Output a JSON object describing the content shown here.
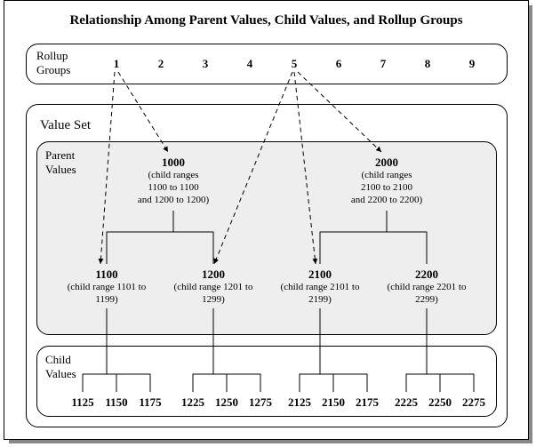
{
  "title": "Relationship Among Parent Values, Child Values, and Rollup Groups",
  "labels": {
    "rollup": "Rollup\nGroups",
    "valueSet": "Value Set",
    "parent": "Parent\nValues",
    "child": "Child\nValues"
  },
  "rollupGroups": [
    "1",
    "2",
    "3",
    "4",
    "5",
    "6",
    "7",
    "8",
    "9"
  ],
  "parents": {
    "p1000": {
      "value": "1000",
      "range": "(child ranges\n1100 to 1100\nand 1200 to 1200)"
    },
    "p2000": {
      "value": "2000",
      "range": "(child ranges\n2100 to 2100\nand 2200 to 2200)"
    },
    "p1100": {
      "value": "1100",
      "range": "(child range 1101 to\n1199)"
    },
    "p1200": {
      "value": "1200",
      "range": "(child range 1201 to\n1299)"
    },
    "p2100": {
      "value": "2100",
      "range": "(child range 2101 to\n2199)"
    },
    "p2200": {
      "value": "2200",
      "range": "(child range 2201 to\n2299)"
    }
  },
  "children": [
    "1125",
    "1150",
    "1175",
    "1225",
    "1250",
    "1275",
    "2125",
    "2150",
    "2175",
    "2225",
    "2250",
    "2275"
  ]
}
